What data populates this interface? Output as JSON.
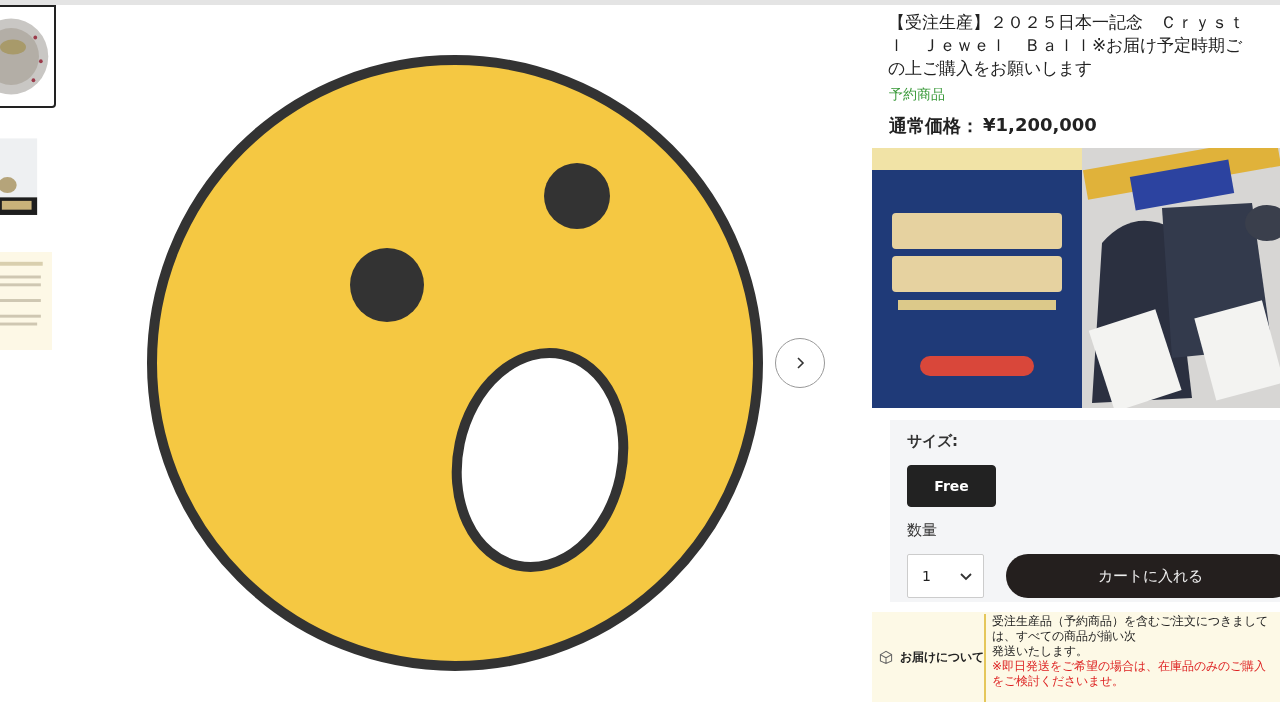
{
  "thumbnails": [
    {
      "kind": "picture",
      "selected": true
    },
    {
      "kind": "picture",
      "selected": false
    },
    {
      "kind": "picture",
      "selected": false
    }
  ],
  "product": {
    "title_lines": [
      "【受注生産】２０２５日本一記念　Ｃｒｙｓｔ",
      "ｌ　Ｊｅｗｅｌ　Ｂａｌｌ※お届け予定時期ご",
      "の上ご購入をお願いします"
    ],
    "tag": "予約商品",
    "price_label": "通常価格：",
    "price": "¥1,200,000",
    "banner": {
      "kind": "picture"
    },
    "size_label": "サイズ:",
    "sizes": [
      {
        "label": "Free",
        "selected": true
      }
    ],
    "quantity_label": "数量",
    "quantity": "1",
    "cart_button": "カートに入れる"
  },
  "delivery": {
    "title": "お届けについて",
    "lines": [
      "受注生産品（予約商品）を含むご注文につきましては、すべての商品が揃い次",
      "発送いたします。"
    ],
    "note": "※即日発送をご希望の場合は、在庫品のみのご購入をご検討くださいませ。"
  }
}
